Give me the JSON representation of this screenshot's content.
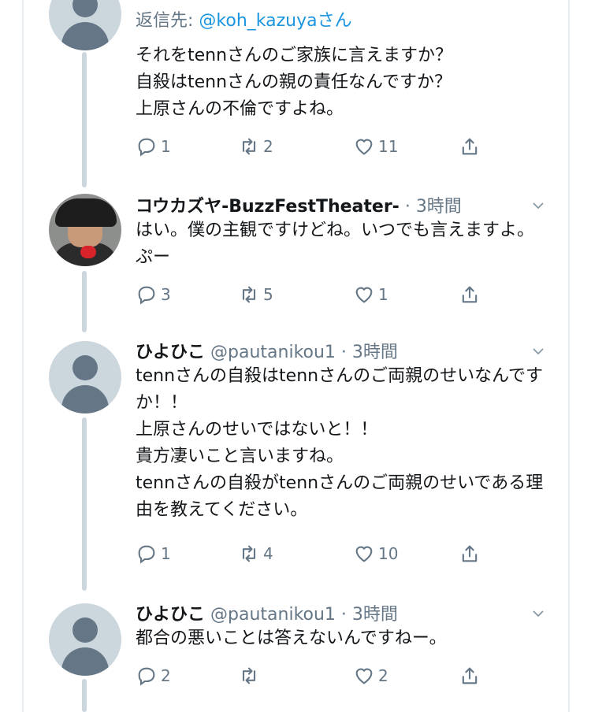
{
  "top_tweet": {
    "reply_prefix": "返信先: ",
    "reply_handle": "@koh_kazuyaさん",
    "text": "それをtennさんのご家族に言えますか？\n自殺はtennさんの親の責任なんですか？\n上原さんの不倫ですよね。",
    "replies": "1",
    "retweets": "2",
    "likes": "11"
  },
  "tweets": [
    {
      "name": "コウカズヤ-BuzzFestTheater-",
      "meta": "· 3時間",
      "text": "はい。僕の主観ですけどね。いつでも言えますよ。ぷー",
      "replies": "3",
      "retweets": "5",
      "likes": "1",
      "avatar": "profile-photo"
    },
    {
      "name": "ひよひこ",
      "meta": "@pautanikou1 · 3時間",
      "text": "tennさんの自殺はtennさんのご両親のせいなんですか！！\n上原さんのせいではないと！！\n貴方凄いこと言いますね。\ntennさんの自殺がtennさんのご両親のせいである理由を教えてください。",
      "replies": "1",
      "retweets": "4",
      "likes": "10",
      "avatar": "default"
    },
    {
      "name": "ひよひこ",
      "meta": "@pautanikou1 · 3時間",
      "text": "都合の悪いことは答えないんですねー。",
      "replies": "2",
      "retweets": "",
      "likes": "2",
      "avatar": "default"
    }
  ],
  "colors": {
    "accent": "#1b95e0",
    "secondary": "#657786",
    "line": "#ccd6dd"
  },
  "icons": [
    "reply-icon",
    "retweet-icon",
    "like-icon",
    "share-icon",
    "chevron-down-icon"
  ]
}
